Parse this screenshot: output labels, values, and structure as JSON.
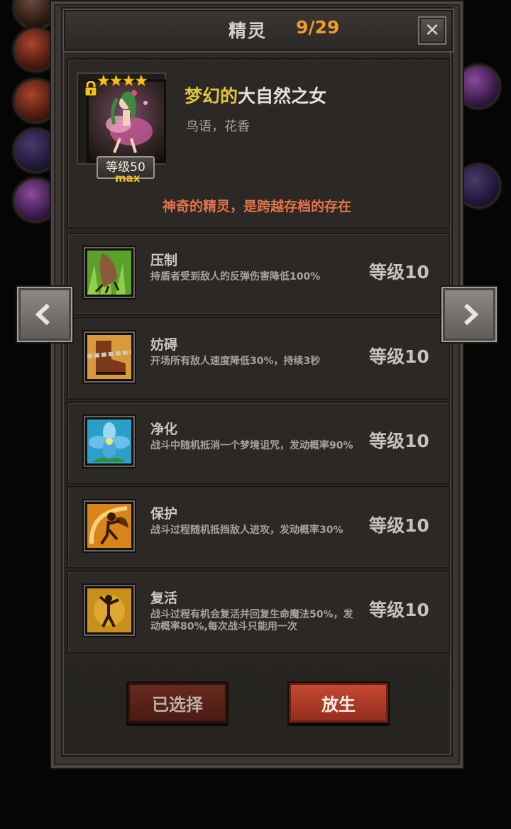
{
  "window": {
    "title": "精灵",
    "count": "9/29",
    "close_glyph": "✕"
  },
  "sprite": {
    "stars": "★★★★",
    "level_label": "等级50",
    "max_label": "max",
    "name_prefix": "梦幻的",
    "name_main": "大自然之女",
    "trait": "鸟语，花香",
    "description": "神奇的精灵，是跨越存档的存在",
    "icons": {
      "lock": "lock-icon",
      "portrait": "fairy-portrait"
    }
  },
  "skills": [
    {
      "name": "压制",
      "desc": "持盾者受到敌人的反弹伤害降低100%",
      "level": "等级10",
      "icon": "claw-icon"
    },
    {
      "name": "妨碍",
      "desc": "开场所有敌人速度降低30%，持续3秒",
      "level": "等级10",
      "icon": "chain-boot-icon"
    },
    {
      "name": "净化",
      "desc": "战斗中随机抵消一个梦境诅咒，发动概率90%",
      "level": "等级10",
      "icon": "blue-flower-icon"
    },
    {
      "name": "保护",
      "desc": "战斗过程随机抵挡敌人进攻，发动概率30%",
      "level": "等级10",
      "icon": "fairy-shield-icon"
    },
    {
      "name": "复活",
      "desc": "战斗过程有机会复活并回复生命魔法50%，发动概率80%,每次战斗只能用一次",
      "level": "等级10",
      "icon": "revive-fairy-icon"
    }
  ],
  "buttons": {
    "selected": "已选择",
    "release": "放生"
  },
  "colors": {
    "title_count": "#f19a2a",
    "name_prefix": "#e2c43a",
    "description": "#e3744a",
    "release_button": "#c84a32"
  }
}
